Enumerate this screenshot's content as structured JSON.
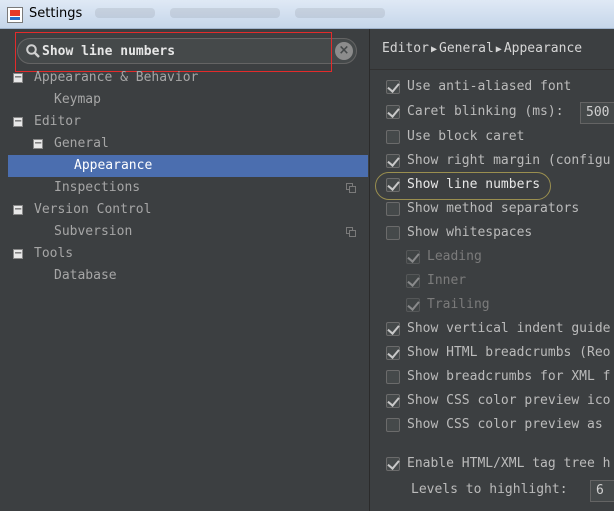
{
  "window": {
    "title": "Settings"
  },
  "search": {
    "value": "Show line numbers",
    "placeholder": ""
  },
  "tree": [
    {
      "label": "Appearance & Behavior",
      "toggle": "−"
    },
    {
      "label": "Keymap"
    },
    {
      "label": "Editor",
      "toggle": "−"
    },
    {
      "label": "General",
      "toggle": "−"
    },
    {
      "label": "Appearance",
      "selected": true
    },
    {
      "label": "Inspections",
      "copy_icon": true
    },
    {
      "label": "Version Control",
      "toggle": "−"
    },
    {
      "label": "Subversion",
      "copy_icon": true
    },
    {
      "label": "Tools",
      "toggle": "−"
    },
    {
      "label": "Database"
    }
  ],
  "breadcrumb": [
    "Editor",
    "General",
    "Appearance"
  ],
  "options": [
    {
      "label": "Use anti-aliased font",
      "checked": true
    },
    {
      "label": "Caret blinking (ms):",
      "checked": true,
      "value": "500"
    },
    {
      "label": "Use block caret",
      "checked": false
    },
    {
      "label": "Show right margin (configu",
      "checked": true
    },
    {
      "label": "Show line numbers",
      "checked": true,
      "highlighted": true
    },
    {
      "label": "Show method separators",
      "checked": false
    },
    {
      "label": "Show whitespaces",
      "checked": false
    },
    {
      "label": "Leading",
      "checked": true,
      "disabled": true
    },
    {
      "label": "Inner",
      "checked": true,
      "disabled": true
    },
    {
      "label": "Trailing",
      "checked": true,
      "disabled": true
    },
    {
      "label": "Show vertical indent guide",
      "checked": true
    },
    {
      "label": "Show HTML breadcrumbs (Reo",
      "checked": true
    },
    {
      "label": "Show breadcrumbs for XML f",
      "checked": false
    },
    {
      "label": "Show CSS color preview ico",
      "checked": true
    },
    {
      "label": "Show CSS color preview as",
      "checked": false
    },
    {
      "label": "Enable HTML/XML tag tree h",
      "checked": true
    }
  ],
  "levels": {
    "label": "Levels to highlight:",
    "value": "6"
  },
  "colors": {
    "selection": "#4b6eaf",
    "search_highlight_box": "#e32b2b"
  }
}
